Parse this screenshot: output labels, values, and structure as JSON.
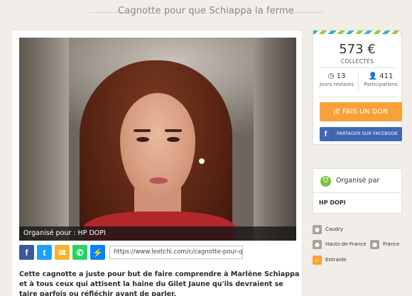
{
  "page_title": "Cagnotte pour que Schiappa la ferme",
  "video": {
    "organizer_caption": "Organisé pour : HP DOPI"
  },
  "share": {
    "buttons": [
      {
        "name": "facebook",
        "glyph": "f"
      },
      {
        "name": "twitter",
        "glyph": "t"
      },
      {
        "name": "email",
        "glyph": "✉"
      },
      {
        "name": "whatsapp",
        "glyph": "✆"
      },
      {
        "name": "messenger",
        "glyph": "⚡"
      }
    ],
    "url": "https://www.leetchi.com/c/cagnotte-pour-qu..."
  },
  "description": "Cette cagnotte a juste pour but de faire comprendre à Marlène Schiappa et à tous ceux qui attisent la haine du Gilet Jaune qu'ils devraient se taire parfois ou réfléchir avant de parler.",
  "stats": {
    "amount": "573 €",
    "amount_label": "COLLECTÉS",
    "days_value": "13",
    "days_label": "Jours restants",
    "participants_value": "411",
    "participants_label": "Participations"
  },
  "actions": {
    "donate_label": "JE FAIS UN DON",
    "facebook_share_label": "PARTAGER SUR FACEBOOK"
  },
  "organizer": {
    "label": "Organisé par",
    "name": "HP DOPI"
  },
  "tags": {
    "city": "Caudry",
    "region": "Hauts-de-France",
    "country": "France",
    "category": "Entraide"
  },
  "colors": {
    "accent_orange": "#f8a13a",
    "facebook_blue": "#3b5998",
    "organizer_green": "#7cc242"
  }
}
